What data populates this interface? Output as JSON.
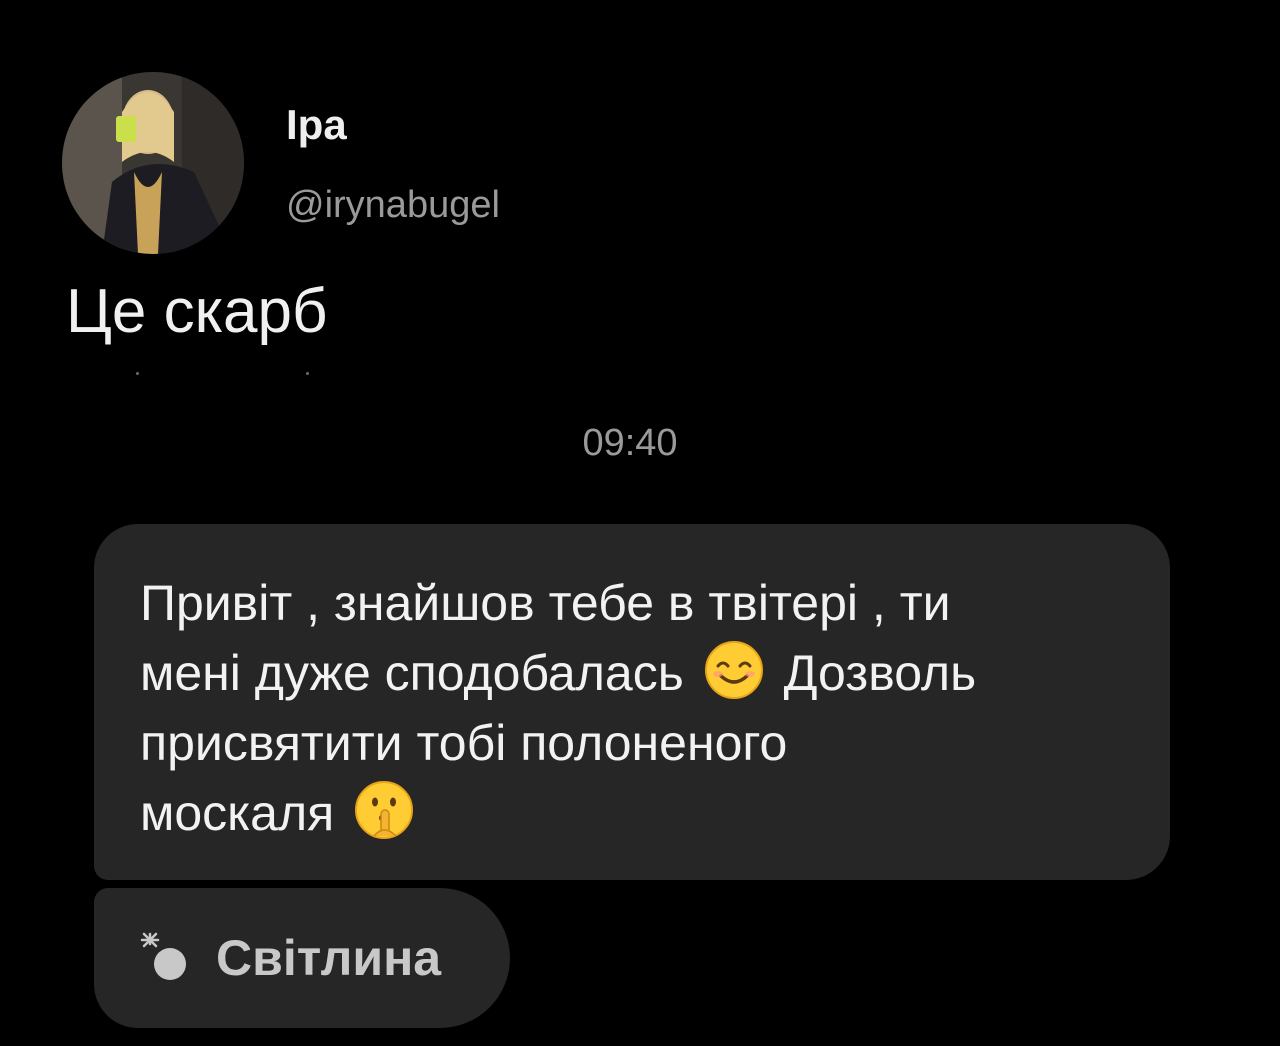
{
  "profile": {
    "name": "Іра",
    "handle": "@irynabugel"
  },
  "caption": "Це скарб",
  "chat": {
    "timestamp": "09:40",
    "message": {
      "line1": "Привіт , знайшов тебе в твітері , ти",
      "line2a": "мені дуже сподобалась",
      "line2_emoji": "smiling-face-icon",
      "line2b": "Дозволь",
      "line3": "присвятити тобі полоненого",
      "line4": "москаля",
      "line4_emoji": "shushing-face-icon"
    },
    "attachment": {
      "icon": "photo-spark-icon",
      "label": "Світлина"
    }
  },
  "colors": {
    "background": "#000000",
    "bubble": "#262626",
    "text": "#f2f2f2",
    "muted": "#9a9a9a"
  }
}
